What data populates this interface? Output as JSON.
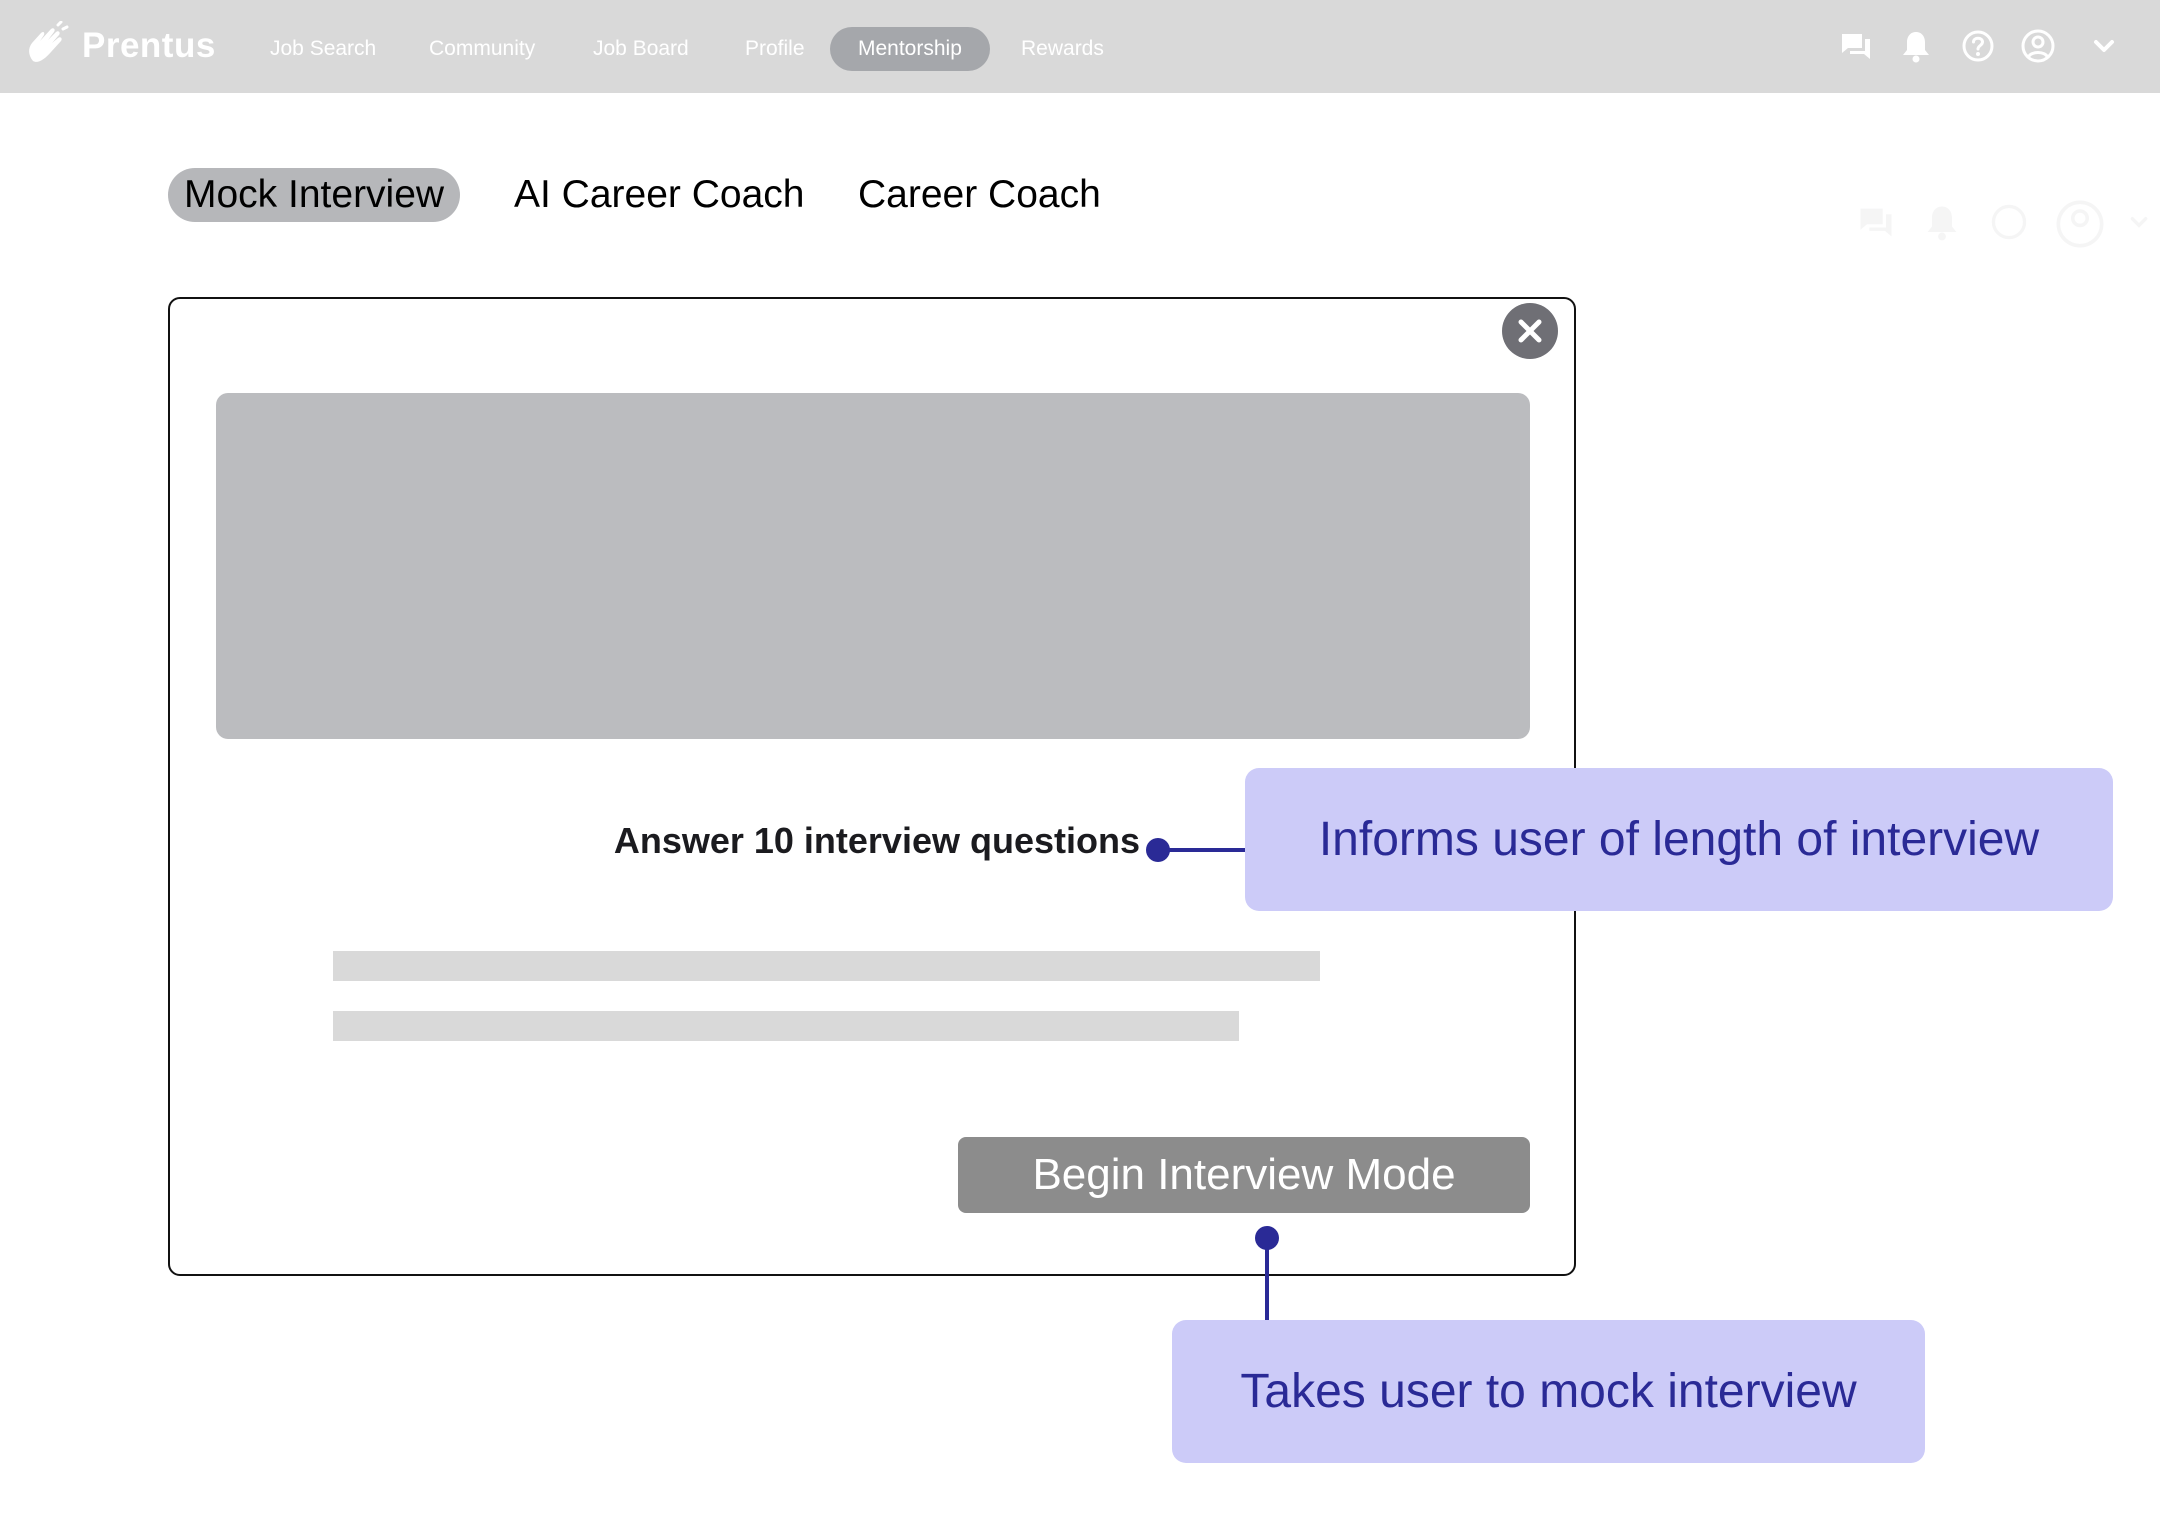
{
  "brand": {
    "name": "Prentus",
    "logo_icon": "hand-wave-logo-icon"
  },
  "nav": {
    "items": [
      {
        "label": "Job Search"
      },
      {
        "label": "Community"
      },
      {
        "label": "Job Board"
      },
      {
        "label": "Profile"
      },
      {
        "label": "Mentorship",
        "active": true
      },
      {
        "label": "Rewards"
      }
    ],
    "icons": [
      "chat-icon",
      "bell-icon",
      "help-icon",
      "account-icon",
      "chevron-down-icon"
    ]
  },
  "subtabs": [
    {
      "label": "Mock Interview",
      "active": true
    },
    {
      "label": "AI Career Coach"
    },
    {
      "label": "Career Coach"
    }
  ],
  "modal": {
    "close_icon": "close-icon",
    "info_text": "Answer 10 interview questions",
    "begin_button_label": "Begin Interview Mode"
  },
  "annotations": [
    {
      "text": "Informs user of length of interview"
    },
    {
      "text": "Takes user to mock interview"
    }
  ],
  "colors": {
    "topbar": "#d9d9d9",
    "nav_active": "#a5a7ab",
    "subtab_active": "#b6b7ba",
    "placeholder": "#bbbcbf",
    "button": "#8c8c8c",
    "annotation_bg": "#cccbf8",
    "annotation_text": "#2a2a96"
  }
}
